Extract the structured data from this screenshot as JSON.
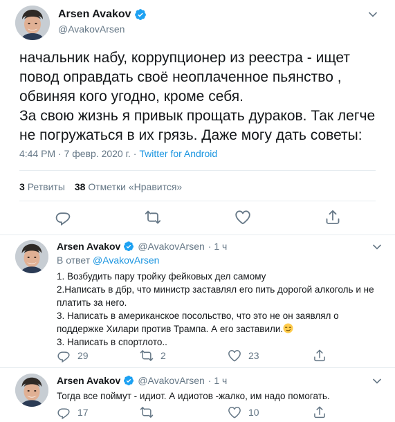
{
  "main_tweet": {
    "author_name": "Arsen Avakov",
    "handle": "@AvakovArsen",
    "body_lines": [
      "начальник набу, коррупционер из реестра - ищет",
      "повод оправдать своё неоплаченное пьянство ,",
      "обвиняя кого угодно, кроме себя.",
      "За свою жизнь я привык прощать дураков. Так легче",
      "не погружаться в их грязь. Даже могу дать советы:"
    ],
    "timestamp": "4:44 PM · 7 февр. 2020 г. · ",
    "source": "Twitter for Android",
    "retweets_count": "3",
    "retweets_label": "Ретвиты",
    "likes_count": "38",
    "likes_label": "Отметки «Нравится»"
  },
  "replies": [
    {
      "author_name": "Arsen Avakov",
      "handle": "@AvakovArsen",
      "time": "· 1 ч",
      "reply_to_label": "В ответ",
      "reply_to_handle": "@AvakovArsen",
      "text_lines": [
        "1. Возбудить пару тройку фейковых дел  самому",
        "2.Написать в дбр, что министр заставлял его пить дорогой алкоголь и не",
        "платить за него.",
        "3. Написать в американское посольство, что это не он заявлял о",
        "поддержке Хилари против Трампа.  А его заставили.",
        "3. Написать в спортлото.."
      ],
      "replies_count": "29",
      "retweets_count": "2",
      "likes_count": "23"
    },
    {
      "author_name": "Arsen Avakov",
      "handle": "@AvakovArsen",
      "time": "· 1 ч",
      "text_lines": [
        "Тогда все поймут - идиот. А идиотов -жалко, им надо помогать."
      ],
      "replies_count": "17",
      "retweets_count": "",
      "likes_count": "10"
    }
  ],
  "colors": {
    "accent": "#1b95e0",
    "text": "#14171a",
    "muted": "#657786",
    "divider": "#e6ecf0"
  },
  "icons": [
    "avatar",
    "verified-badge-icon",
    "chevron-down-icon",
    "reply-icon",
    "retweet-icon",
    "like-icon",
    "share-icon",
    "smirk-emoji-icon"
  ]
}
